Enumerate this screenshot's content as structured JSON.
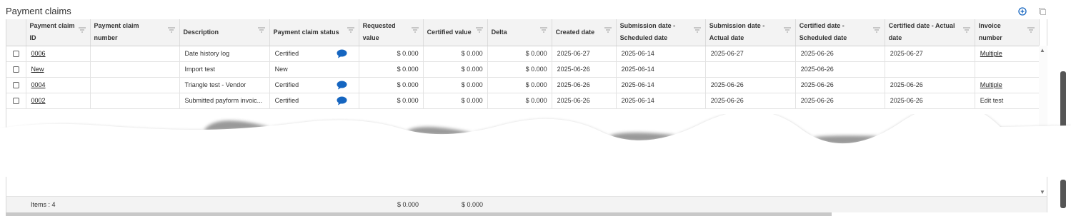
{
  "section": {
    "title": "Payment claims"
  },
  "toolbar": {
    "add_icon": "plus-circle-icon",
    "copy_icon": "copy-icon"
  },
  "columns": [
    "Payment claim\nID",
    "Payment claim\nnumber",
    "Description",
    "Payment claim status",
    "Requested\nvalue",
    "Certified value",
    "Delta",
    "Created date",
    "Submission date -\nScheduled date",
    "Submission date -\nActual date",
    "Certified date -\nScheduled date",
    "Certified date - Actual\ndate",
    "Invoice number"
  ],
  "rows": [
    {
      "id": "0006",
      "number": "",
      "description": "Date history log",
      "status": "Certified",
      "has_comment": true,
      "requested": "$ 0.000",
      "certified": "$ 0.000",
      "delta": "$ 0.000",
      "created": "2025-06-27",
      "sub_sched": "2025-06-14",
      "sub_actual": "2025-06-27",
      "cert_sched": "2025-06-26",
      "cert_actual": "2025-06-27",
      "invoice": "Multiple",
      "invoice_link": true
    },
    {
      "id": "New",
      "number": "",
      "description": "Import test",
      "status": "New",
      "has_comment": false,
      "requested": "$ 0.000",
      "certified": "$ 0.000",
      "delta": "$ 0.000",
      "created": "2025-06-26",
      "sub_sched": "2025-06-14",
      "sub_actual": "",
      "cert_sched": "2025-06-26",
      "cert_actual": "",
      "invoice": "",
      "invoice_link": false
    },
    {
      "id": "0004",
      "number": "",
      "description": "Triangle test - Vendor",
      "status": "Certified",
      "has_comment": true,
      "requested": "$ 0.000",
      "certified": "$ 0.000",
      "delta": "$ 0.000",
      "created": "2025-06-26",
      "sub_sched": "2025-06-14",
      "sub_actual": "2025-06-26",
      "cert_sched": "2025-06-26",
      "cert_actual": "2025-06-26",
      "invoice": "Multiple",
      "invoice_link": true
    },
    {
      "id": "0002",
      "number": "",
      "description": "Submitted payform invoic...",
      "status": "Certified",
      "has_comment": true,
      "requested": "$ 0.000",
      "certified": "$ 0.000",
      "delta": "$ 0.000",
      "created": "2025-06-26",
      "sub_sched": "2025-06-14",
      "sub_actual": "2025-06-26",
      "cert_sched": "2025-06-26",
      "cert_actual": "2025-06-26",
      "invoice": "Edit test",
      "invoice_link": false
    }
  ],
  "footer": {
    "items": "Items : 4",
    "requested_total": "$ 0.000",
    "certified_total": "$ 0.000"
  },
  "colors": {
    "accent": "#1565c0",
    "comment": "#1565c0",
    "header_bg": "#f3f3f3",
    "border": "#dcdcdc"
  }
}
